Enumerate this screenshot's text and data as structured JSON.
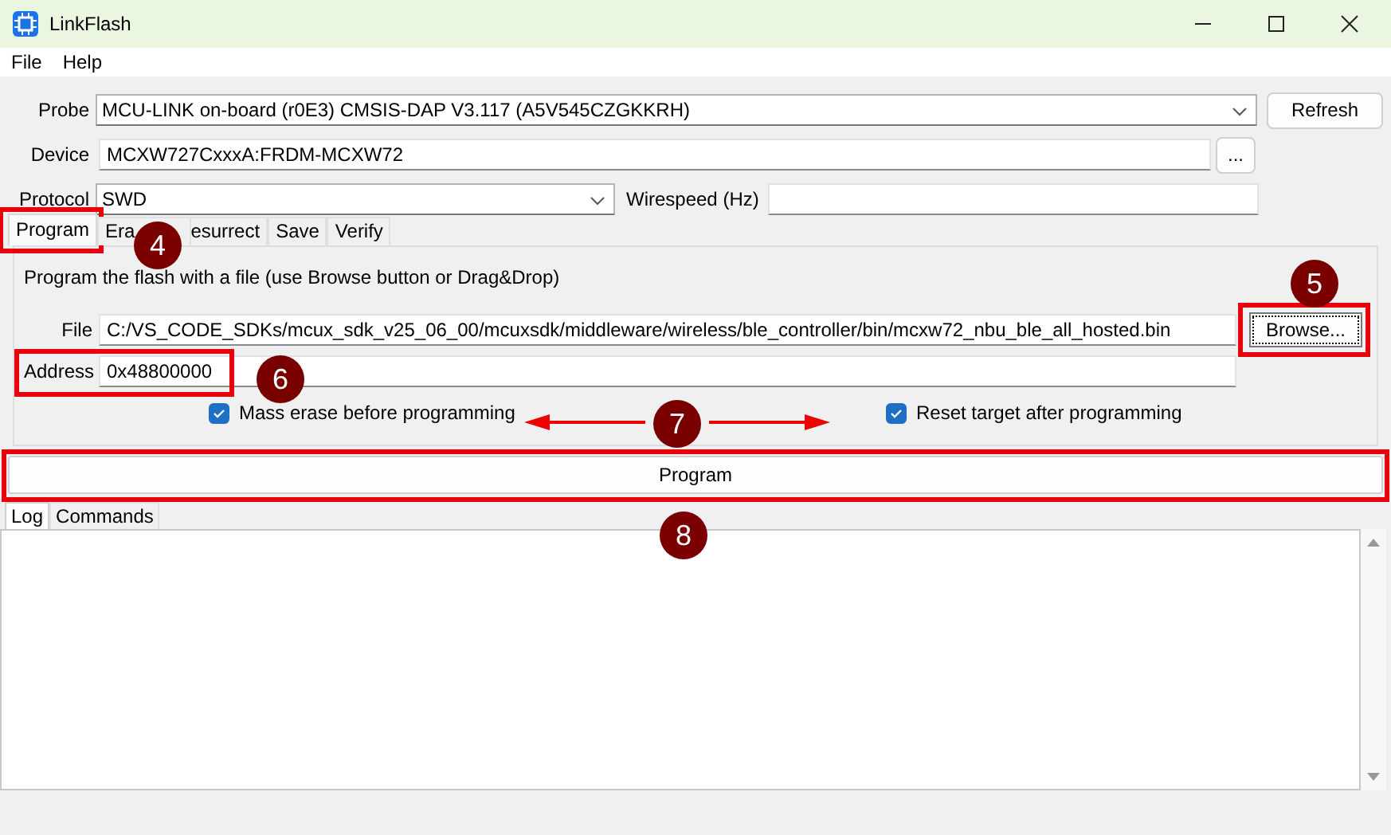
{
  "window": {
    "title": "LinkFlash"
  },
  "menu": [
    "File",
    "Help"
  ],
  "probe": {
    "label": "Probe",
    "value": "MCU-LINK on-board (r0E3) CMSIS-DAP V3.117 (A5V545CZGKKRH)",
    "button": "Refresh"
  },
  "device": {
    "label": "Device",
    "value": "MCXW727CxxxA:FRDM-MCXW72",
    "button": "..."
  },
  "protocol": {
    "label": "Protocol",
    "value": "SWD",
    "wirespeed_label": "Wirespeed (Hz)"
  },
  "tabs": [
    {
      "label": "Program",
      "selected": true,
      "highlighted": true
    },
    {
      "label": "Era",
      "selected": false,
      "highlighted": false
    },
    {
      "label": "esurrect",
      "selected": false,
      "highlighted": false
    },
    {
      "label": "Save",
      "selected": false,
      "highlighted": false
    },
    {
      "label": "Verify",
      "selected": false,
      "highlighted": false
    }
  ],
  "program_panel": {
    "description": "Program the flash with a file (use Browse button or Drag&Drop)",
    "file": {
      "label": "File",
      "value": "C:/VS_CODE_SDKs/mcux_sdk_v25_06_00/mcuxsdk/middleware/wireless/ble_controller/bin/mcxw72_nbu_ble_all_hosted.bin",
      "button": "Browse...",
      "highlighted": true
    },
    "address": {
      "label": "Address",
      "value": "0x48800000",
      "highlighted": true
    },
    "options": [
      {
        "label": "Mass erase before programming",
        "checked": true
      },
      {
        "label": "Reset target after programming",
        "checked": true
      }
    ],
    "program_button": {
      "label": "Program",
      "highlighted": true
    }
  },
  "log_tabs": [
    {
      "label": "Log",
      "selected": true
    },
    {
      "label": "Commands",
      "selected": false
    }
  ],
  "badges": [
    {
      "label": "4",
      "kind": "plain"
    },
    {
      "label": "5",
      "kind": "plain"
    },
    {
      "label": "6",
      "kind": "plain"
    },
    {
      "label": "7",
      "kind": "arrows"
    },
    {
      "label": "8",
      "kind": "plain"
    }
  ]
}
